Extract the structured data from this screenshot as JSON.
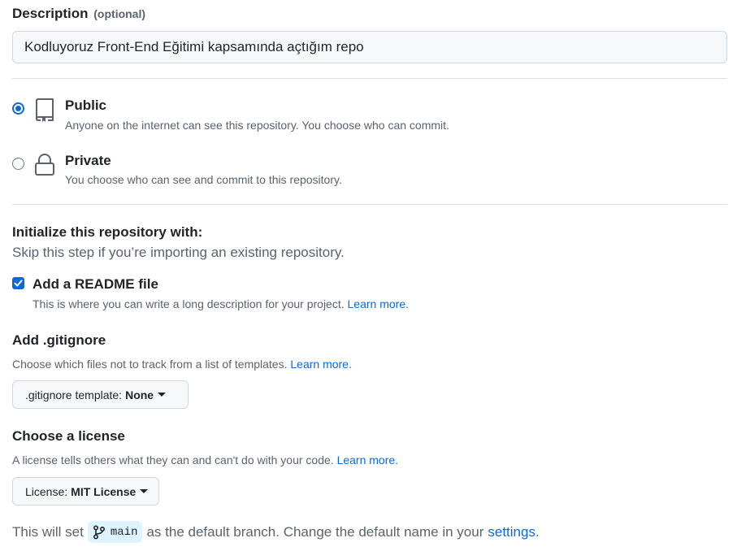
{
  "description": {
    "label": "Description",
    "optional": "(optional)",
    "value": "Kodluyoruz Front-End Eğitimi kapsamında açtığım repo"
  },
  "visibility": {
    "public": {
      "title": "Public",
      "subtitle": "Anyone on the internet can see this repository. You choose who can commit.",
      "selected": true,
      "icon": "repo-icon"
    },
    "private": {
      "title": "Private",
      "subtitle": "You choose who can see and commit to this repository.",
      "selected": false,
      "icon": "lock-icon"
    }
  },
  "initialize": {
    "title": "Initialize this repository with:",
    "subtitle": "Skip this step if you’re importing an existing repository.",
    "readme": {
      "label": "Add a README file",
      "checked": true,
      "note": "This is where you can write a long description for your project.",
      "learn_more": "Learn more."
    }
  },
  "gitignore": {
    "title": "Add .gitignore",
    "note": "Choose which files not to track from a list of templates.",
    "learn_more": "Learn more.",
    "button_prefix": ".gitignore template:",
    "button_value": "None"
  },
  "license": {
    "title": "Choose a license",
    "note": "A license tells others what they can and can't do with your code.",
    "learn_more": "Learn more.",
    "button_prefix": "License:",
    "button_value": "MIT License"
  },
  "branch": {
    "text_before": "This will set",
    "name": "main",
    "text_after": "as the default branch. Change the default name in your",
    "settings_link": "settings",
    "period": "."
  },
  "colors": {
    "accent": "#0969da",
    "branch_chip_bg": "#ddf4ff"
  }
}
